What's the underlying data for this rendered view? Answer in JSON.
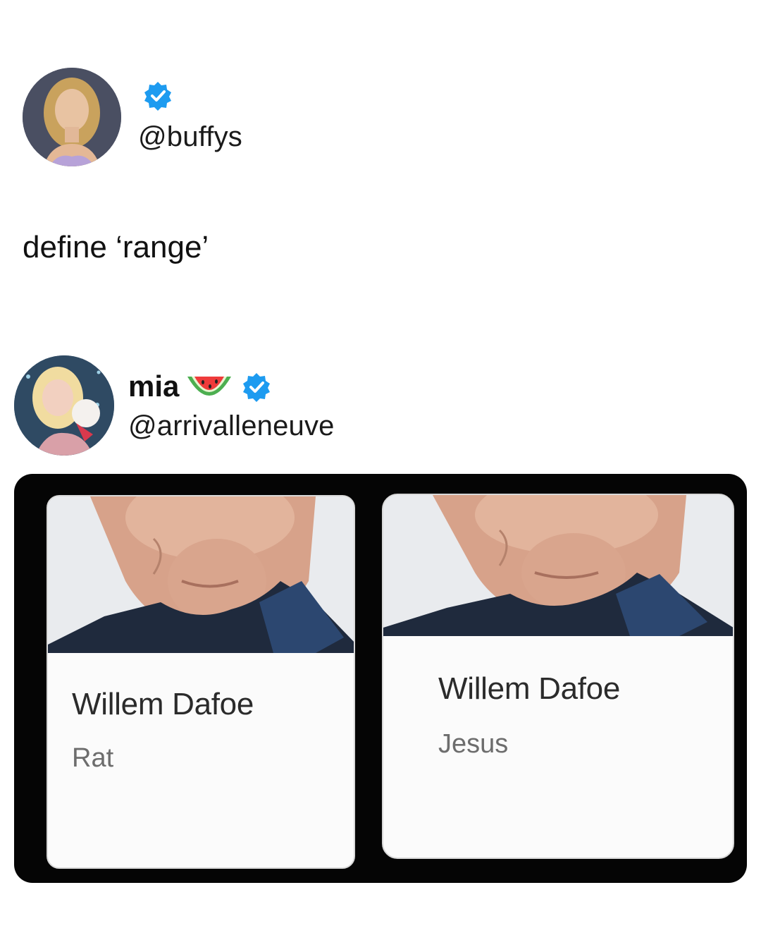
{
  "tweet1": {
    "avatar": "avatar-photo",
    "handle": "@buffys",
    "verified_icon": "verified-badge-icon",
    "text": "define ‘range’"
  },
  "tweet2": {
    "avatar": "avatar-photo",
    "display_name": "mia",
    "emoji_icon": "watermelon-icon",
    "verified_icon": "verified-badge-icon",
    "handle": "@arrivalleneuve",
    "media": {
      "cards": [
        {
          "title": "Willem Dafoe",
          "subtitle": "Rat"
        },
        {
          "title": "Willem Dafoe",
          "subtitle": "Jesus"
        }
      ]
    }
  },
  "colors": {
    "background": "#ffffff",
    "text": "#1a1a1a",
    "verified": "#1d9bf0",
    "frame": "#050505",
    "card_subtitle": "#6d6d6d"
  }
}
